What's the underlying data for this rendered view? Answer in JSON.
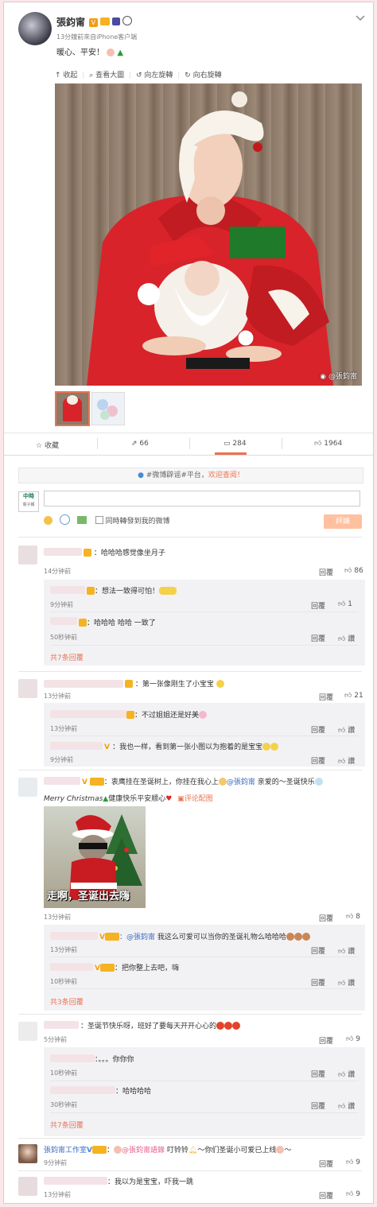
{
  "post": {
    "author": "張鈞甯",
    "meta": "13分鐘前來自iPhone客户端",
    "text": "暖心、平安！",
    "collapse_icon": "chevron-down"
  },
  "toolbar": {
    "collapse": "收起",
    "view_large": "查看大圖",
    "rotate_left": "向左旋轉",
    "rotate_right": "向右旋轉"
  },
  "image": {
    "watermark": "@張鈞甯"
  },
  "actions": {
    "favorite": "收藏",
    "repost_count": "66",
    "comment_count": "284",
    "like_count": "1964"
  },
  "notice": {
    "text_prefix": "#微博辟谣#平台，",
    "text_link": "欢迎查阅！"
  },
  "composer": {
    "logo_top": "中時",
    "logo_bottom": "電子報",
    "placeholder": "",
    "also_post_label": "同時轉發到我的微博",
    "submit": "評論"
  },
  "comments": [
    {
      "text": "：哈哈哈感觉像坐月子",
      "time": "14分钟前",
      "reply": "回覆",
      "likes": "86",
      "replies": [
        {
          "text": "：想法一致得可怕！",
          "time": "9分钟前",
          "reply": "回覆",
          "likes": "1"
        },
        {
          "text": "：哈哈哈 哈哈 一致了",
          "time": "50秒钟前",
          "reply": "回覆",
          "likes": "讚"
        }
      ],
      "more": "共7条回覆"
    },
    {
      "text": "：第一张像刚生了小宝宝",
      "time": "13分钟前",
      "reply": "回覆",
      "likes": "21",
      "replies": [
        {
          "text": "：不过姐姐还是好美",
          "time": "13分钟前",
          "reply": "回覆",
          "likes": "讚"
        },
        {
          "text": "：我也一样，看到第一张小图以为抱着的是宝宝",
          "time": "9分钟前",
          "reply": "回覆",
          "likes": "讚"
        }
      ]
    },
    {
      "text": "：衷鹰挂在圣诞树上，你挂在我心上",
      "mention": "@張鈞甯",
      "text2": " 亲爱的～圣诞快乐",
      "line2a": "Merry Christmas",
      "line2b": "健康快乐平安顺心",
      "comment_image_link": "评论配图",
      "meme_caption": "走啊，圣诞出去嗨",
      "time": "13分钟前",
      "reply": "回覆",
      "likes": "8",
      "replies": [
        {
          "mention": "：@張鈞甯",
          "text": " 我这么可爱可以当你的圣诞礼物么哈哈哈",
          "time": "13分钟前",
          "reply": "回覆",
          "likes": "讚"
        },
        {
          "text": "：把你整上去吧，嗨",
          "time": "10秒钟前",
          "reply": "回覆",
          "likes": "讚"
        }
      ],
      "more": "共3条回覆"
    },
    {
      "text": "：圣诞节快乐呀，班好了要每天开开心心的",
      "time": "5分钟前",
      "reply": "回覆",
      "likes": "9",
      "replies": [
        {
          "text": "：。。。你你你",
          "time": "10秒钟前",
          "reply": "回覆",
          "likes": "讚"
        },
        {
          "text": "：哈哈哈哈",
          "time": "30秒钟前",
          "reply": "回覆",
          "likes": "讚"
        }
      ],
      "more": "共7条回覆"
    },
    {
      "author": "張鈞甯工作室",
      "mention": "@張鈞甯語錄",
      "text": "：",
      "text2": " 叮铃铃",
      "text3": "～你们圣诞小可爱已上线",
      "text4": "～",
      "time": "9分钟前",
      "reply": "回覆",
      "likes": "9"
    },
    {
      "text": "：我以为是宝宝，吓我一跳",
      "time": "13分钟前",
      "reply": "回覆",
      "likes": "9"
    }
  ],
  "colors": {
    "accent": "#eb7350",
    "link": "#eb7350",
    "mention": "#3b6cc1",
    "submit_bg": "#ffc09f"
  }
}
